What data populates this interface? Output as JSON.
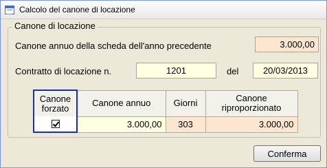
{
  "window": {
    "title": "Calcolo del canone di locazione"
  },
  "group": {
    "legend": "Canone di locazione",
    "annual_prev_label": "Canone annuo della scheda dell'anno precedente",
    "annual_prev_value": "3.000,00",
    "contract_label": "Contratto di locazione n.",
    "contract_number": "1201",
    "date_label": "del",
    "contract_date": "20/03/2013"
  },
  "table": {
    "headers": {
      "forced": "Canone forzato",
      "annual": "Canone annuo",
      "days": "Giorni",
      "prorated": "Canone riproporzionato"
    },
    "row": {
      "forced_checked": true,
      "annual": "3.000,00",
      "days": "303",
      "prorated": "3.000,00"
    }
  },
  "buttons": {
    "confirm": "Conferma"
  },
  "colors": {
    "selection_border": "#1a2eb0",
    "readonly_field": "#fde6cf",
    "editable_field": "#ffffe1"
  }
}
